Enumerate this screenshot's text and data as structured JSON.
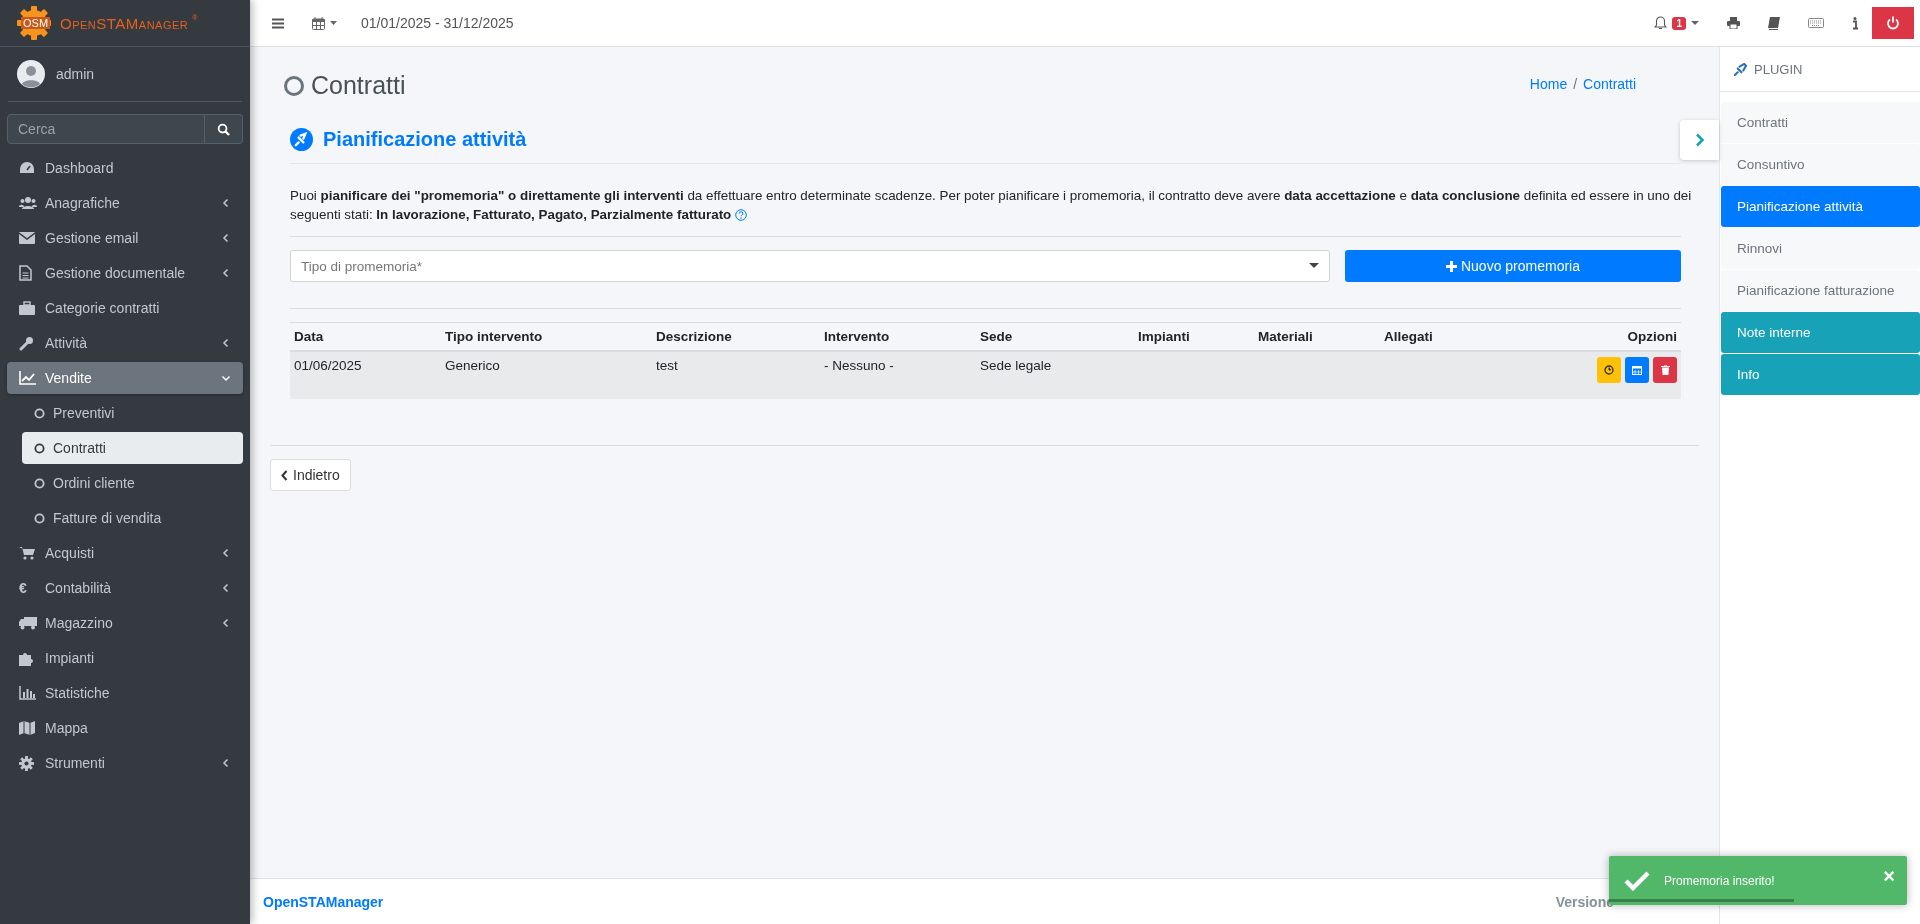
{
  "app": {
    "logo_mark": "OSM",
    "name": "OpenSTAManager",
    "registered": "®"
  },
  "user": {
    "name": "admin"
  },
  "search": {
    "placeholder": "Cerca"
  },
  "menu": [
    {
      "label": "Dashboard",
      "selected": false
    },
    {
      "label": "Anagrafiche",
      "expanded": false,
      "selected": false
    },
    {
      "label": "Gestione email",
      "expanded": false,
      "selected": false
    },
    {
      "label": "Gestione documentale",
      "expanded": false,
      "selected": false
    },
    {
      "label": "Categorie contratti",
      "selected": false
    },
    {
      "label": "Attività",
      "expanded": false,
      "selected": false
    },
    {
      "label": "Vendite",
      "expanded": true,
      "selected": true,
      "children": [
        {
          "label": "Preventivi",
          "selected": false
        },
        {
          "label": "Contratti",
          "selected": true
        },
        {
          "label": "Ordini cliente",
          "selected": false
        },
        {
          "label": "Fatture di vendita",
          "selected": false
        }
      ]
    },
    {
      "label": "Acquisti",
      "expanded": false,
      "selected": false
    },
    {
      "icon_text": "€",
      "label": "Contabilità",
      "expanded": false,
      "selected": false
    },
    {
      "label": "Magazzino",
      "expanded": false,
      "selected": false
    },
    {
      "label": "Impianti",
      "selected": false
    },
    {
      "label": "Statistiche",
      "selected": false
    },
    {
      "label": "Mappa",
      "selected": false
    },
    {
      "label": "Strumenti",
      "expanded": false,
      "selected": false
    }
  ],
  "topbar": {
    "date_range": "01/01/2025 - 31/12/2025",
    "notifications": "1"
  },
  "page": {
    "title": "Contratti",
    "breadcrumb": [
      {
        "label": "Home"
      },
      {
        "label": "Contratti"
      }
    ],
    "breadcrumb_separator": "/"
  },
  "card": {
    "title": "Pianificazione attività",
    "description_lines": [
      "Puoi **pianificare dei \"promemoria\" o direttamente gli interventi** da effettuare entro determinate scadenze. Per poter pianificare i promemoria, il contratto deve avere **data accettazione** e **data conclusione** definita ed essere in uno dei",
      "seguenti stati: **In lavorazione, Fatturato, Pagato, Parzialmente fatturato**"
    ],
    "select_placeholder": "Tipo di promemoria*",
    "add_button": "Nuovo promemoria"
  },
  "table": {
    "columns": [
      "Data",
      "Tipo intervento",
      "Descrizione",
      "Intervento",
      "Sede",
      "Impianti",
      "Materiali",
      "Allegati",
      "Opzioni"
    ],
    "rows": [
      {
        "cells": [
          "01/06/2025",
          "Generico",
          "test",
          "- Nessuno -",
          "Sede legale",
          "",
          "",
          ""
        ]
      }
    ]
  },
  "back_button": "Indietro",
  "plugins": {
    "header": "PLUGIN",
    "items": [
      {
        "label": "Contratti",
        "kind": "link",
        "selected": false
      },
      {
        "label": "Consuntivo",
        "kind": "link",
        "selected": false
      },
      {
        "label": "Pianificazione attività",
        "kind": "link",
        "selected": true
      },
      {
        "label": "Rinnovi",
        "kind": "link",
        "selected": false
      },
      {
        "label": "Pianificazione fatturazione",
        "kind": "link",
        "selected": false
      },
      {
        "label": "Note interne",
        "kind": "panel",
        "selected": false
      },
      {
        "label": "Info",
        "kind": "panel",
        "selected": false
      }
    ]
  },
  "footer": {
    "brand": "OpenSTAManager",
    "version": "Versione"
  },
  "toast": {
    "message": "Promemoria inserito!",
    "close": "×",
    "level": 0.62
  }
}
